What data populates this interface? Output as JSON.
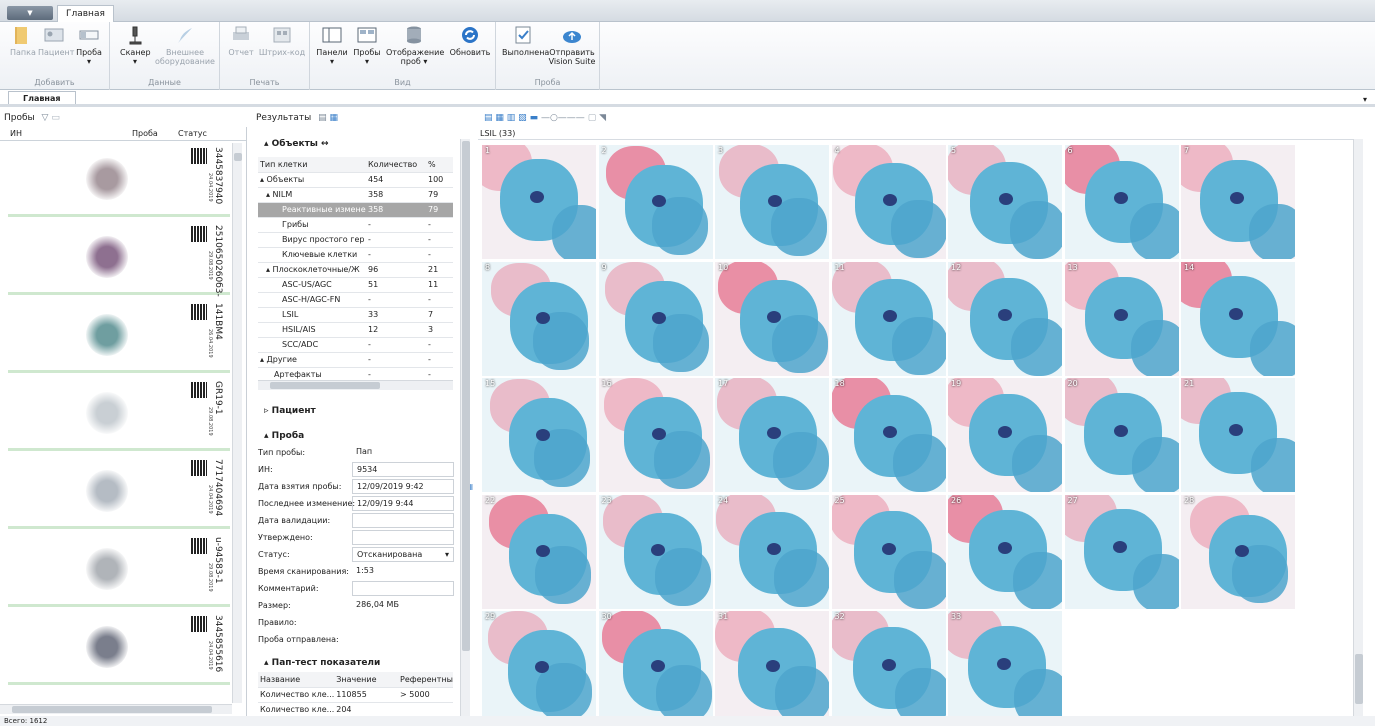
{
  "window": {
    "app_button": "▼",
    "main_tab": "Главная"
  },
  "ribbon": {
    "groups": [
      {
        "label": "Добавить",
        "buttons": [
          "Папка",
          "Пациент",
          "Проба"
        ]
      },
      {
        "label": "Данные",
        "buttons": [
          "Сканер",
          "Внешнее оборудование"
        ]
      },
      {
        "label": "Печать",
        "buttons": [
          "Отчет",
          "Штрих-код"
        ]
      },
      {
        "label": "Вид",
        "buttons": [
          "Панели",
          "Пробы",
          "Отображение проб",
          "Обновить"
        ]
      },
      {
        "label": "Проба",
        "buttons": [
          "Выполнена",
          "Отправить Vision Suite"
        ]
      }
    ]
  },
  "doc_tab": "Главная",
  "samples_panel": {
    "title": "Пробы",
    "columns": [
      "ИН",
      "Проба",
      "Статус"
    ],
    "items": [
      {
        "id": "3445837940",
        "date": "24.04.2019"
      },
      {
        "id": "2510650260б3-",
        "date": "29.08.2019"
      },
      {
        "id": "141ВМ4",
        "date": "26.04.2019"
      },
      {
        "id": "GR19-1",
        "date": "29.08.2019"
      },
      {
        "id": "7717404694",
        "date": "24.04.2019"
      },
      {
        "id": "u-94583-1",
        "date": "29.08.2019"
      },
      {
        "id": "3445855616",
        "date": "24.04.2019"
      }
    ],
    "footer": "Всего: 1612"
  },
  "results": {
    "title": "Результаты",
    "objects_header": "Объекты",
    "columns": [
      "Тип клетки",
      "Количество",
      "%"
    ],
    "rows": [
      {
        "name": "▴ Объекты",
        "count": "454",
        "pct": "100"
      },
      {
        "name": "▴ NILM",
        "count": "358",
        "pct": "79"
      },
      {
        "name": "Реактивные измене",
        "count": "358",
        "pct": "79"
      },
      {
        "name": "Грибы",
        "count": "-",
        "pct": "-"
      },
      {
        "name": "Вирус простого гер",
        "count": "-",
        "pct": "-"
      },
      {
        "name": "Ключевые клетки",
        "count": "-",
        "pct": "-"
      },
      {
        "name": "▴ Плоскоклеточные/Ж",
        "count": "96",
        "pct": "21"
      },
      {
        "name": "ASC-US/AGC",
        "count": "51",
        "pct": "11"
      },
      {
        "name": "ASC-H/AGC-FN",
        "count": "-",
        "pct": "-"
      },
      {
        "name": "LSIL",
        "count": "33",
        "pct": "7"
      },
      {
        "name": "HSIL/AIS",
        "count": "12",
        "pct": "3"
      },
      {
        "name": "SCC/ADC",
        "count": "-",
        "pct": "-"
      },
      {
        "name": "▴ Другие",
        "count": "-",
        "pct": "-"
      },
      {
        "name": "Артефакты",
        "count": "-",
        "pct": "-"
      }
    ],
    "patient_header": "Пациент",
    "sample_header": "Проба",
    "fields": [
      {
        "label": "Тип пробы:",
        "value": "Пап"
      },
      {
        "label": "ИН:",
        "value": "9534"
      },
      {
        "label": "Дата взятия пробы:",
        "value": "12/09/2019 9:42"
      },
      {
        "label": "Последнее изменение:",
        "value": "12/09/19 9:44"
      },
      {
        "label": "Дата валидации:",
        "value": ""
      },
      {
        "label": "Утверждено:",
        "value": ""
      },
      {
        "label": "Статус:",
        "value": "Отсканирована"
      },
      {
        "label": "Время сканирования:",
        "value": "1:53"
      },
      {
        "label": "Комментарий:",
        "value": ""
      },
      {
        "label": "Размер:",
        "value": "286,04 МБ"
      },
      {
        "label": "Правило:",
        "value": ""
      },
      {
        "label": "Проба отправлена:",
        "value": ""
      }
    ],
    "pap_header": "Пап-тест показатели",
    "pap_columns": [
      "Название",
      "Значение",
      "Референтны"
    ],
    "pap_rows": [
      {
        "name": "Количество кле...",
        "value": "110855",
        "ref": "> 5000"
      },
      {
        "name": "Количество кле...",
        "value": "204",
        "ref": ""
      }
    ]
  },
  "gallery": {
    "title": "LSIL (33)",
    "tiles": [
      "1",
      "2",
      "3",
      "4",
      "5",
      "6",
      "7",
      "8",
      "9",
      "10",
      "11",
      "12",
      "13",
      "14",
      "15",
      "16",
      "17",
      "18",
      "19",
      "20",
      "21",
      "22",
      "23",
      "24",
      "25",
      "26",
      "27",
      "28",
      "29",
      "30",
      "31",
      "32",
      "33"
    ],
    "colors": {
      "blue_cell": "#5fb4d6",
      "pink_cell": "#e8849c",
      "nucleus": "#2a3f7c"
    }
  }
}
